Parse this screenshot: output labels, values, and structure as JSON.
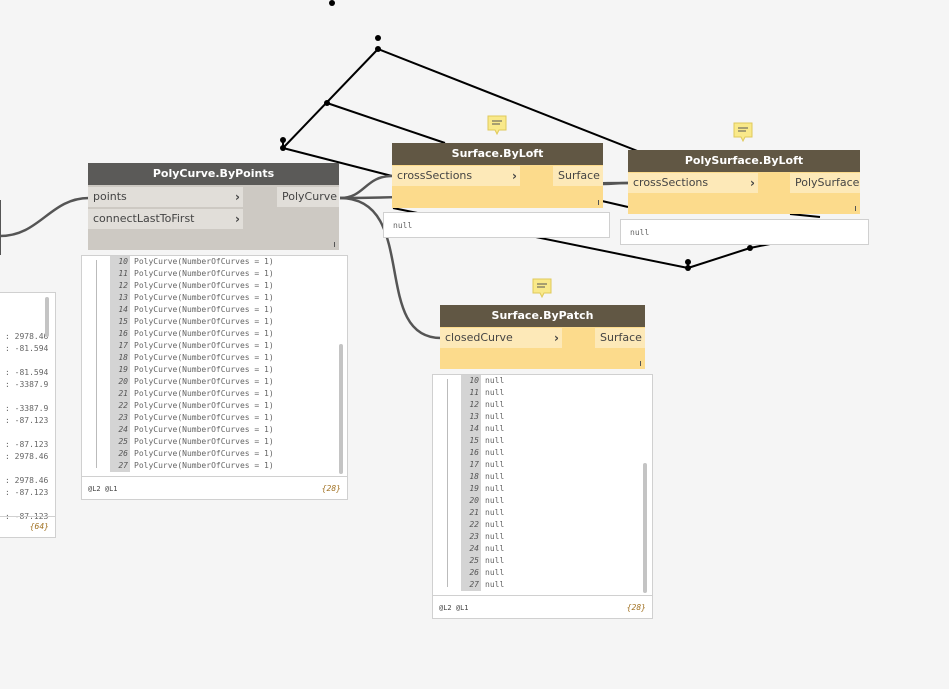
{
  "colors": {
    "canvas": "#f5f5f5",
    "wire": "#555555",
    "node_header_active": "#615744",
    "node_header_inactive": "#5b5a58",
    "node_body_active": "#fcdb8c",
    "node_body_inactive": "#cdc9c3",
    "port_active": "#fde9b8",
    "port_inactive": "#e1ded9",
    "note_icon": "#f9e98a"
  },
  "nodes": {
    "polycurve_by_points": {
      "title": "PolyCurve.ByPoints",
      "inputs": [
        "points",
        "connectLastToFirst"
      ],
      "output": "PolyCurve",
      "preview": {
        "first_index": 10,
        "value": "PolyCurve(NumberOfCurves = 1)",
        "count": 18,
        "levels": "@L2 @L1",
        "total": "{28}"
      }
    },
    "surface_by_loft": {
      "title": "Surface.ByLoft",
      "input": "crossSections",
      "output": "Surface",
      "preview_text": "null"
    },
    "polysurface_by_loft": {
      "title": "PolySurface.ByLoft",
      "input": "crossSections",
      "output": "PolySurface",
      "preview_text": "null"
    },
    "surface_by_patch": {
      "title": "Surface.ByPatch",
      "input": "closedCurve",
      "output": "Surface",
      "preview": {
        "first_index": 10,
        "value": "null",
        "count": 18,
        "levels": "@L2 @L1",
        "total": "{28}"
      }
    }
  },
  "left_watch": {
    "values": [
      "2978.46",
      "-81.594",
      "",
      "-81.594",
      "-3387.9",
      "",
      "-3387.9",
      "-87.123",
      "",
      "-87.123",
      "2978.46",
      "",
      "2978.46",
      "-87.123",
      "",
      "-87.123"
    ],
    "total": "{64}"
  }
}
